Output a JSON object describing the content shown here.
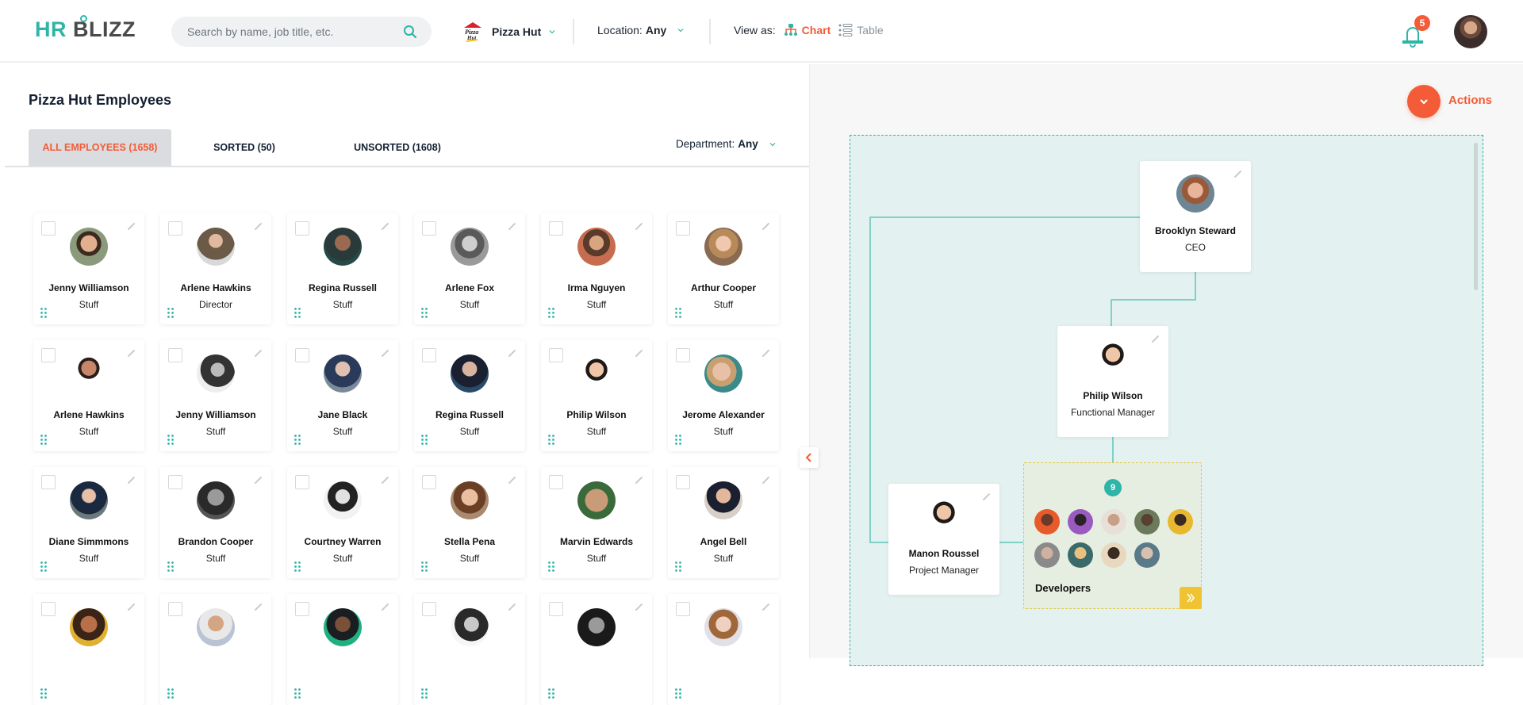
{
  "header": {
    "logo": {
      "part1": "HR",
      "part2": "BLIZZ"
    },
    "search": {
      "placeholder": "Search by name, job title, etc.",
      "value": "",
      "icon": "search-icon"
    },
    "company": {
      "name": "Pizza Hut",
      "icon": "pizza-hut-logo"
    },
    "location": {
      "label": "Location:",
      "value": "Any"
    },
    "view_as": {
      "label": "View as:",
      "options": [
        {
          "label": "Chart",
          "icon": "org-chart-icon",
          "active": true
        },
        {
          "label": "Table",
          "icon": "table-list-icon",
          "active": false
        }
      ]
    },
    "notifications": {
      "icon": "bell-icon",
      "count": "5"
    },
    "user_avatar": "avatar"
  },
  "left_panel": {
    "title": "Pizza Hut Employees",
    "tabs": [
      {
        "label": "ALL EMPLOYEES (1658)",
        "active": true
      },
      {
        "label": "SORTED (50)",
        "active": false
      },
      {
        "label": "UNSORTED  (1608)",
        "active": false
      }
    ],
    "department": {
      "label": "Department:",
      "value": "Any"
    },
    "employees": [
      {
        "name": "Jenny Williamson",
        "role": "Stuff"
      },
      {
        "name": "Arlene Hawkins",
        "role": "Director"
      },
      {
        "name": "Regina Russell",
        "role": "Stuff"
      },
      {
        "name": "Arlene Fox",
        "role": "Stuff"
      },
      {
        "name": "Irma Nguyen",
        "role": "Stuff"
      },
      {
        "name": "Arthur Cooper",
        "role": "Stuff"
      },
      {
        "name": "Arlene Hawkins",
        "role": "Stuff"
      },
      {
        "name": "Jenny Williamson",
        "role": "Stuff"
      },
      {
        "name": "Jane Black",
        "role": "Stuff"
      },
      {
        "name": "Regina Russell",
        "role": "Stuff"
      },
      {
        "name": "Philip Wilson",
        "role": "Stuff"
      },
      {
        "name": "Jerome Alexander",
        "role": "Stuff"
      },
      {
        "name": "Diane Simmmons",
        "role": "Stuff"
      },
      {
        "name": "Brandon Cooper",
        "role": "Stuff"
      },
      {
        "name": "Courtney Warren",
        "role": "Stuff"
      },
      {
        "name": "Stella Pena",
        "role": "Stuff"
      },
      {
        "name": "Marvin Edwards",
        "role": "Stuff"
      },
      {
        "name": "Angel Bell",
        "role": "Stuff"
      },
      {
        "name": "",
        "role": ""
      },
      {
        "name": "",
        "role": ""
      },
      {
        "name": "",
        "role": ""
      },
      {
        "name": "",
        "role": ""
      },
      {
        "name": "",
        "role": ""
      },
      {
        "name": "",
        "role": ""
      }
    ]
  },
  "right_panel": {
    "actions_label": "Actions",
    "org_chart": {
      "ceo": {
        "name": "Brooklyn Steward",
        "role": "CEO"
      },
      "manager": {
        "name": "Philip Wilson",
        "role": "Functional Manager"
      },
      "project_manager": {
        "name": "Manon Roussel",
        "role": "Project Manager"
      },
      "group": {
        "name": "Developers",
        "count": "9"
      }
    }
  },
  "colors": {
    "accent": "#f45b37",
    "teal": "#2fb5a7",
    "canvas_bg": "#e3f2f0",
    "group_border": "#e5c547"
  }
}
